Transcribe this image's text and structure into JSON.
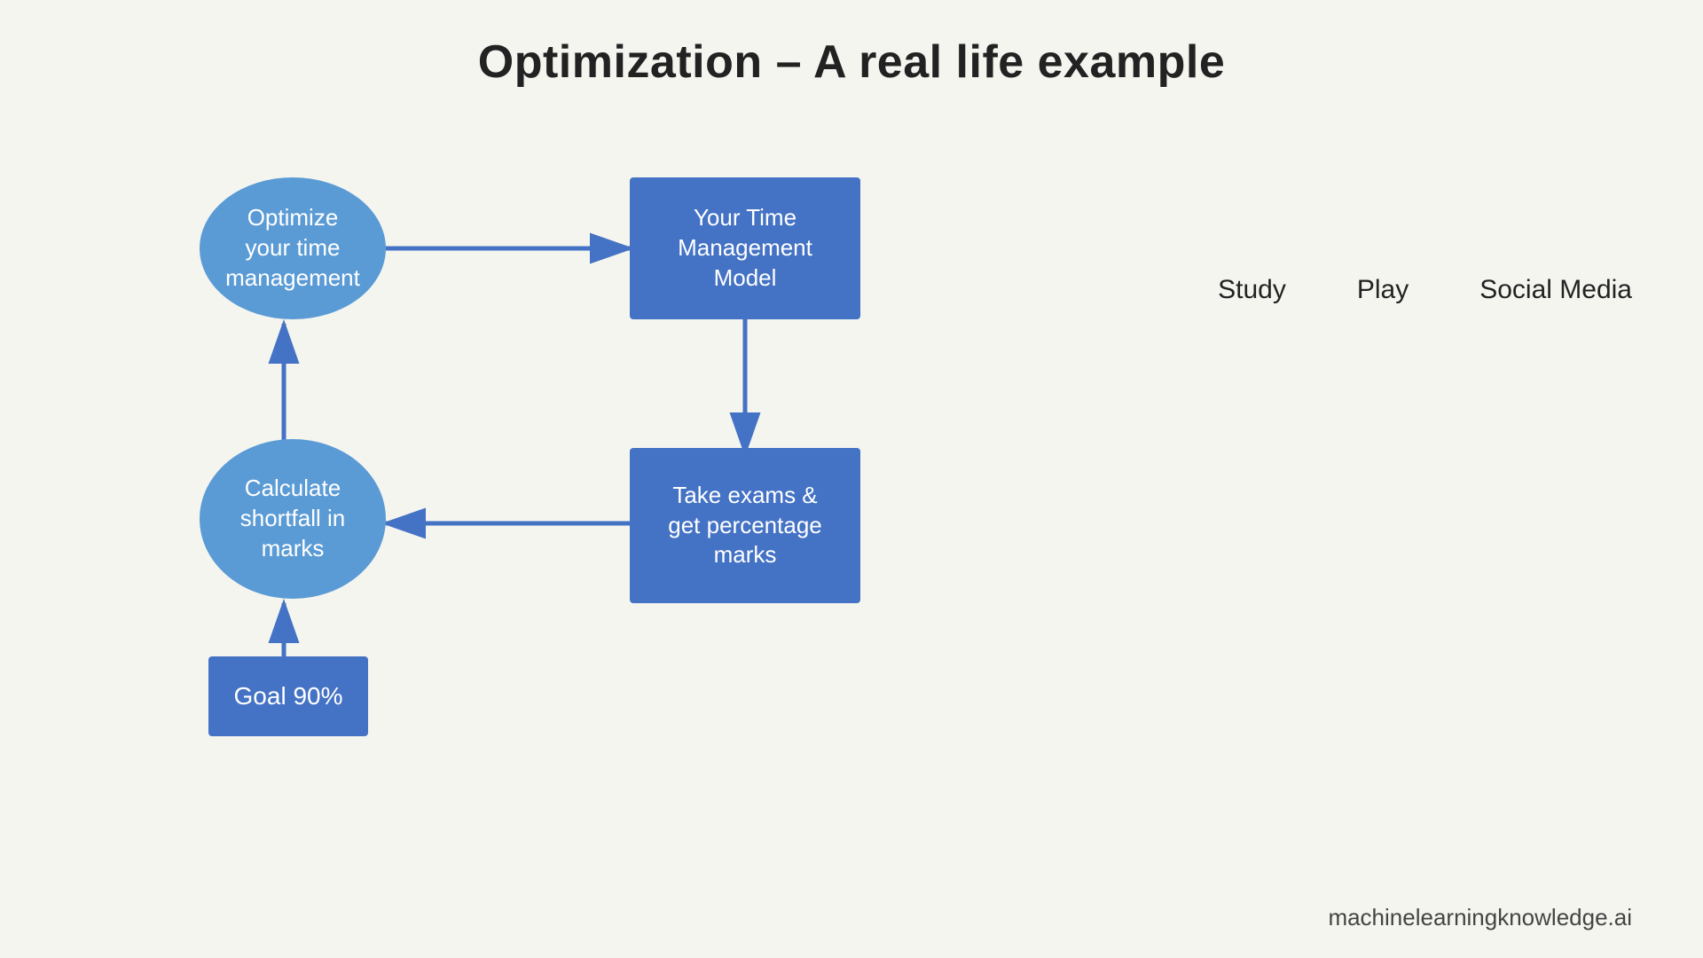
{
  "page": {
    "title": "Optimization – A real life example",
    "footer": "machinelearningknowledge.ai"
  },
  "nodes": {
    "optimize": {
      "label": "Optimize\nyour time\nmanagement",
      "type": "ellipse"
    },
    "time_model": {
      "label": "Your Time\nManagement\nModel",
      "type": "rect"
    },
    "calculate": {
      "label": "Calculate\nshortfall in\nmarks",
      "type": "ellipse"
    },
    "take_exams": {
      "label": "Take exams &\nget percentage\nmarks",
      "type": "rect"
    },
    "goal": {
      "label": "Goal 90%",
      "type": "rect"
    }
  },
  "side_labels": {
    "study": "Study",
    "play": "Play",
    "social_media": "Social Media"
  },
  "colors": {
    "ellipse_fill": "#5b9bd5",
    "rect_fill": "#4472c4",
    "arrow_color": "#4472c4"
  }
}
